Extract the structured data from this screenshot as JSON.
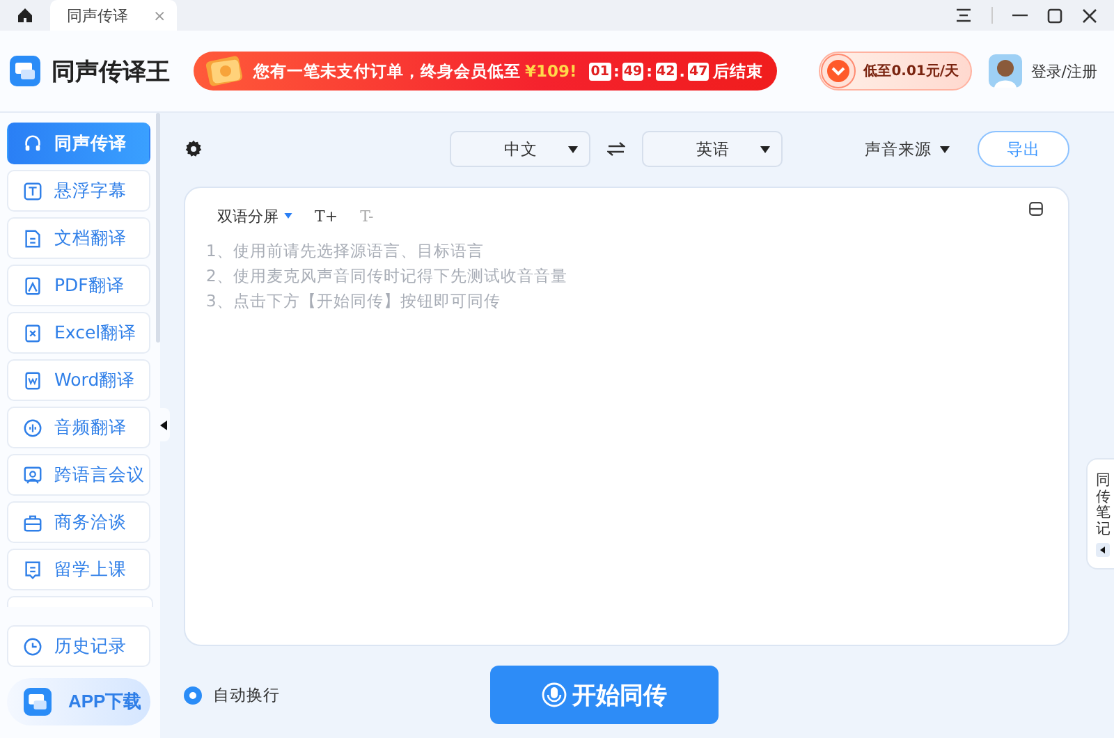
{
  "tab_bar": {
    "tabs": [
      {
        "label": "同声传译",
        "selected": true,
        "close": "×"
      }
    ]
  },
  "header": {
    "app_name": "同声传译王",
    "promo": {
      "text": "您有一笔未支付订单，终身会员低至",
      "price": "¥109!",
      "countdown": [
        {
          "kind": "digit",
          "text": "01"
        },
        {
          "kind": "sep",
          "text": ":"
        },
        {
          "kind": "digit",
          "text": "49"
        },
        {
          "kind": "sep",
          "text": ":"
        },
        {
          "kind": "digit",
          "text": "42"
        },
        {
          "kind": "sep",
          "text": "."
        },
        {
          "kind": "digit",
          "text": "47"
        }
      ],
      "suffix": "后结束"
    },
    "vip_badge": "低至0.01元/天",
    "login": "登录/注册"
  },
  "sidebar": {
    "items": [
      {
        "label": "同声传译",
        "selected": true
      },
      {
        "label": "悬浮字幕",
        "selected": false
      },
      {
        "label": "文档翻译",
        "selected": false
      },
      {
        "label": "PDF翻译",
        "selected": false
      },
      {
        "label": "Excel翻译",
        "selected": false
      },
      {
        "label": "Word翻译",
        "selected": false
      },
      {
        "label": "音频翻译",
        "selected": false
      },
      {
        "label": "跨语言会议",
        "selected": false
      },
      {
        "label": "商务洽谈",
        "selected": false
      },
      {
        "label": "留学上课",
        "selected": false
      }
    ],
    "history": "历史记录",
    "app_download": "APP下载"
  },
  "toolbar": {
    "source_language": "中文",
    "target_language": "英语",
    "sound_source": "声音来源",
    "export": "导出"
  },
  "editor": {
    "view_mode": "双语分屏",
    "font_buttons": [
      {
        "label": "T+",
        "disabled": false
      },
      {
        "label": "T-",
        "disabled": true
      }
    ],
    "hints": [
      "1、使用前请先选择源语言、目标语言",
      "2、使用麦克风声音同传时记得下先测试收音音量",
      "3、点击下方【开始同传】按钮即可同传"
    ]
  },
  "footer": {
    "auto_wrap": {
      "label": "自动换行",
      "checked": true
    },
    "start_button": "开始同传"
  },
  "notes_tab": "同传笔记"
}
